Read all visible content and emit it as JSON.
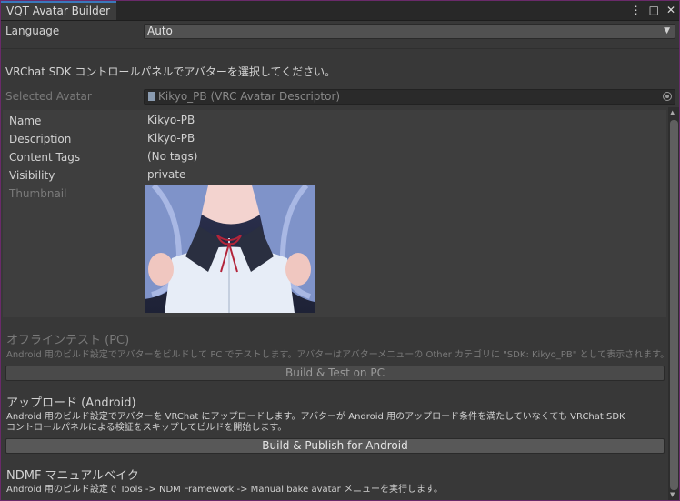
{
  "window": {
    "tab_title": "VQT Avatar Builder",
    "controls": [
      "⋮",
      "□",
      "✕"
    ]
  },
  "language": {
    "label": "Language",
    "value": "Auto"
  },
  "instruction": "VRChat SDK コントロールパネルでアバターを選択してください。",
  "selected_avatar": {
    "label": "Selected Avatar",
    "value": "Kikyo_PB (VRC Avatar Descriptor)"
  },
  "details": {
    "name_label": "Name",
    "name_value": "Kikyo-PB",
    "description_label": "Description",
    "description_value": "Kikyo-PB",
    "content_tags_label": "Content Tags",
    "content_tags_value": "(No tags)",
    "visibility_label": "Visibility",
    "visibility_value": "private",
    "thumbnail_label": "Thumbnail"
  },
  "offline_test": {
    "title": "オフラインテスト (PC)",
    "description": "Android 用のビルド設定でアバターをビルドして PC でテストします。アバターはアバターメニューの Other カテゴリに \"SDK: Kikyo_PB\" として表示されます。",
    "button": "Build & Test on PC"
  },
  "upload": {
    "title": "アップロード (Android)",
    "description_line1": "Android 用のビルド設定でアバターを VRChat にアップロードします。アバターが Android 用のアップロード条件を満たしていなくても VRChat SDK",
    "description_line2": "コントロールパネルによる検証をスキップしてビルドを開始します。",
    "button": "Build & Publish for Android"
  },
  "ndmf": {
    "title": "NDMF マニュアルベイク",
    "description": "Android 用のビルド設定で Tools -> NDM Framework -> Manual bake avatar メニューを実行します。"
  },
  "colors": {
    "background": "#383838",
    "window_border": "#6a2a6a",
    "tab_accent": "#3a79bb"
  }
}
